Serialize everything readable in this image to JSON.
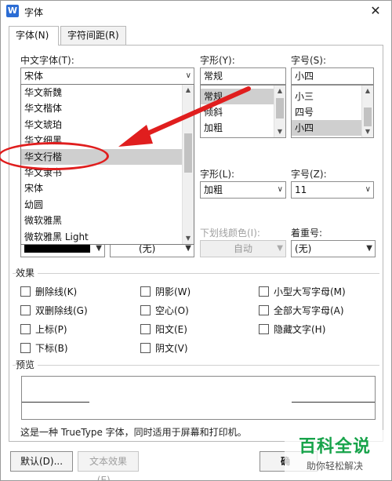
{
  "window": {
    "title": "字体"
  },
  "tabs": [
    {
      "label": "字体(N)"
    },
    {
      "label": "字符间距(R)"
    }
  ],
  "chinese_font": {
    "label": "中文字体(T):",
    "value": "宋体"
  },
  "font_dropdown": {
    "items": [
      "华文新魏",
      "华文楷体",
      "华文琥珀",
      "华文细黑",
      "华文行楷",
      "华文隶书",
      "宋体",
      "幼圆",
      "微软雅黑",
      "微软雅黑 Light"
    ],
    "selected": "华文行楷"
  },
  "style": {
    "label": "字形(Y):",
    "value": "常规",
    "options": [
      "常规",
      "倾斜",
      "加粗"
    ],
    "selected": "常规"
  },
  "size": {
    "label": "字号(S):",
    "value": "小四",
    "options": [
      "小三",
      "四号",
      "小四"
    ],
    "selected": "小四"
  },
  "style2": {
    "label": "字形(L):",
    "value": "加粗"
  },
  "size2": {
    "label": "字号(Z):",
    "value": "11"
  },
  "font_color": {
    "text": "(无)"
  },
  "underline_color": {
    "label": "下划线颜色(I):",
    "value": "自动"
  },
  "emphasis": {
    "label": "着重号:",
    "value": "(无)"
  },
  "effects": {
    "title": "效果",
    "items": [
      "删除线(K)",
      "双删除线(G)",
      "上标(P)",
      "下标(B)",
      "阴影(W)",
      "空心(O)",
      "阳文(E)",
      "阴文(V)",
      "小型大写字母(M)",
      "全部大写字母(A)",
      "隐藏文字(H)"
    ]
  },
  "preview": {
    "title": "预览",
    "description": "这是一种 TrueType 字体，同时适用于屏幕和打印机。"
  },
  "buttons": {
    "default": "默认(D)...",
    "text_effects": "文本效果(E)...",
    "ok": "确"
  },
  "watermark": {
    "main": "百科全说",
    "sub": "助你轻松解决"
  },
  "colors": {
    "annotation": "#e01e1e",
    "watermark": "#17a34a"
  }
}
